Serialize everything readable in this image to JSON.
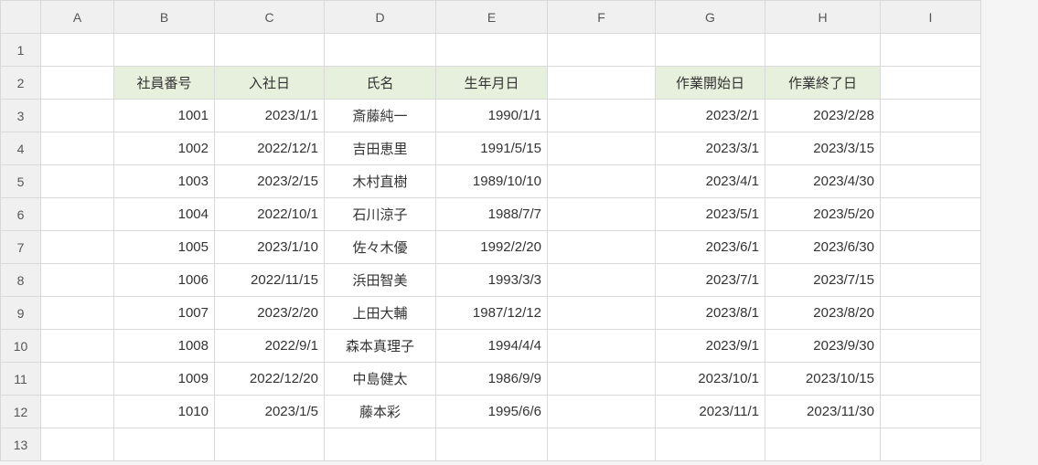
{
  "columns": [
    "A",
    "B",
    "C",
    "D",
    "E",
    "F",
    "G",
    "H",
    "I"
  ],
  "rowCount": 13,
  "headers": {
    "B": "社員番号",
    "C": "入社日",
    "D": "氏名",
    "E": "生年月日",
    "G": "作業開始日",
    "H": "作業終了日"
  },
  "rows": [
    {
      "B": "1001",
      "C": "2023/1/1",
      "D": "斎藤純一",
      "E": "1990/1/1",
      "G": "2023/2/1",
      "H": "2023/2/28"
    },
    {
      "B": "1002",
      "C": "2022/12/1",
      "D": "吉田恵里",
      "E": "1991/5/15",
      "G": "2023/3/1",
      "H": "2023/3/15"
    },
    {
      "B": "1003",
      "C": "2023/2/15",
      "D": "木村直樹",
      "E": "1989/10/10",
      "G": "2023/4/1",
      "H": "2023/4/30"
    },
    {
      "B": "1004",
      "C": "2022/10/1",
      "D": "石川涼子",
      "E": "1988/7/7",
      "G": "2023/5/1",
      "H": "2023/5/20"
    },
    {
      "B": "1005",
      "C": "2023/1/10",
      "D": "佐々木優",
      "E": "1992/2/20",
      "G": "2023/6/1",
      "H": "2023/6/30"
    },
    {
      "B": "1006",
      "C": "2022/11/15",
      "D": "浜田智美",
      "E": "1993/3/3",
      "G": "2023/7/1",
      "H": "2023/7/15"
    },
    {
      "B": "1007",
      "C": "2023/2/20",
      "D": "上田大輔",
      "E": "1987/12/12",
      "G": "2023/8/1",
      "H": "2023/8/20"
    },
    {
      "B": "1008",
      "C": "2022/9/1",
      "D": "森本真理子",
      "E": "1994/4/4",
      "G": "2023/9/1",
      "H": "2023/9/30"
    },
    {
      "B": "1009",
      "C": "2022/12/20",
      "D": "中島健太",
      "E": "1986/9/9",
      "G": "2023/10/1",
      "H": "2023/10/15"
    },
    {
      "B": "1010",
      "C": "2023/1/5",
      "D": "藤本彩",
      "E": "1995/6/6",
      "G": "2023/11/1",
      "H": "2023/11/30"
    }
  ],
  "chart_data": {
    "type": "table",
    "title": "",
    "tables": [
      {
        "columns": [
          "社員番号",
          "入社日",
          "氏名",
          "生年月日"
        ],
        "rows": [
          [
            1001,
            "2023/1/1",
            "斎藤純一",
            "1990/1/1"
          ],
          [
            1002,
            "2022/12/1",
            "吉田恵里",
            "1991/5/15"
          ],
          [
            1003,
            "2023/2/15",
            "木村直樹",
            "1989/10/10"
          ],
          [
            1004,
            "2022/10/1",
            "石川涼子",
            "1988/7/7"
          ],
          [
            1005,
            "2023/1/10",
            "佐々木優",
            "1992/2/20"
          ],
          [
            1006,
            "2022/11/15",
            "浜田智美",
            "1993/3/3"
          ],
          [
            1007,
            "2023/2/20",
            "上田大輔",
            "1987/12/12"
          ],
          [
            1008,
            "2022/9/1",
            "森本真理子",
            "1994/4/4"
          ],
          [
            1009,
            "2022/12/20",
            "中島健太",
            "1986/9/9"
          ],
          [
            1010,
            "2023/1/5",
            "藤本彩",
            "1995/6/6"
          ]
        ]
      },
      {
        "columns": [
          "作業開始日",
          "作業終了日"
        ],
        "rows": [
          [
            "2023/2/1",
            "2023/2/28"
          ],
          [
            "2023/3/1",
            "2023/3/15"
          ],
          [
            "2023/4/1",
            "2023/4/30"
          ],
          [
            "2023/5/1",
            "2023/5/20"
          ],
          [
            "2023/6/1",
            "2023/6/30"
          ],
          [
            "2023/7/1",
            "2023/7/15"
          ],
          [
            "2023/8/1",
            "2023/8/20"
          ],
          [
            "2023/9/1",
            "2023/9/30"
          ],
          [
            "2023/10/1",
            "2023/10/15"
          ],
          [
            "2023/11/1",
            "2023/11/30"
          ]
        ]
      }
    ]
  }
}
